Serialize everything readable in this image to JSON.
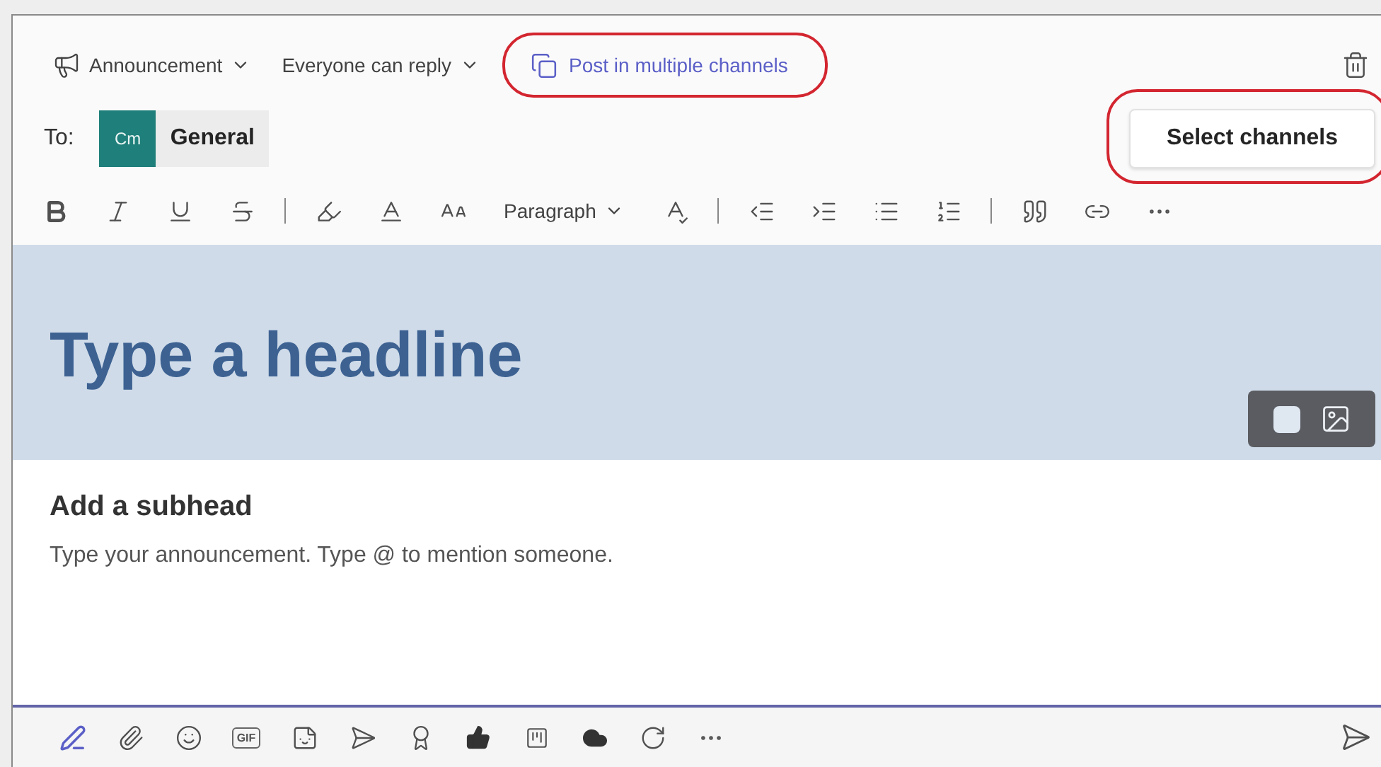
{
  "header": {
    "post_type": "Announcement",
    "reply_setting": "Everyone can reply",
    "multi_channel_link": {
      "label": "Post in multiple channels",
      "highlighted": true
    }
  },
  "recipients": {
    "label": "To:",
    "channels": [
      {
        "initials": "Cm",
        "name": "General"
      }
    ],
    "select_button": {
      "label": "Select channels",
      "highlighted": true
    }
  },
  "format_toolbar": {
    "style_dropdown": "Paragraph"
  },
  "banner": {
    "headline_placeholder": "Type a headline"
  },
  "subhead_placeholder": "Add a subhead",
  "body_placeholder": "Type your announcement. Type @ to mention someone.",
  "compose_toolbar": {
    "gif_label": "GIF"
  }
}
